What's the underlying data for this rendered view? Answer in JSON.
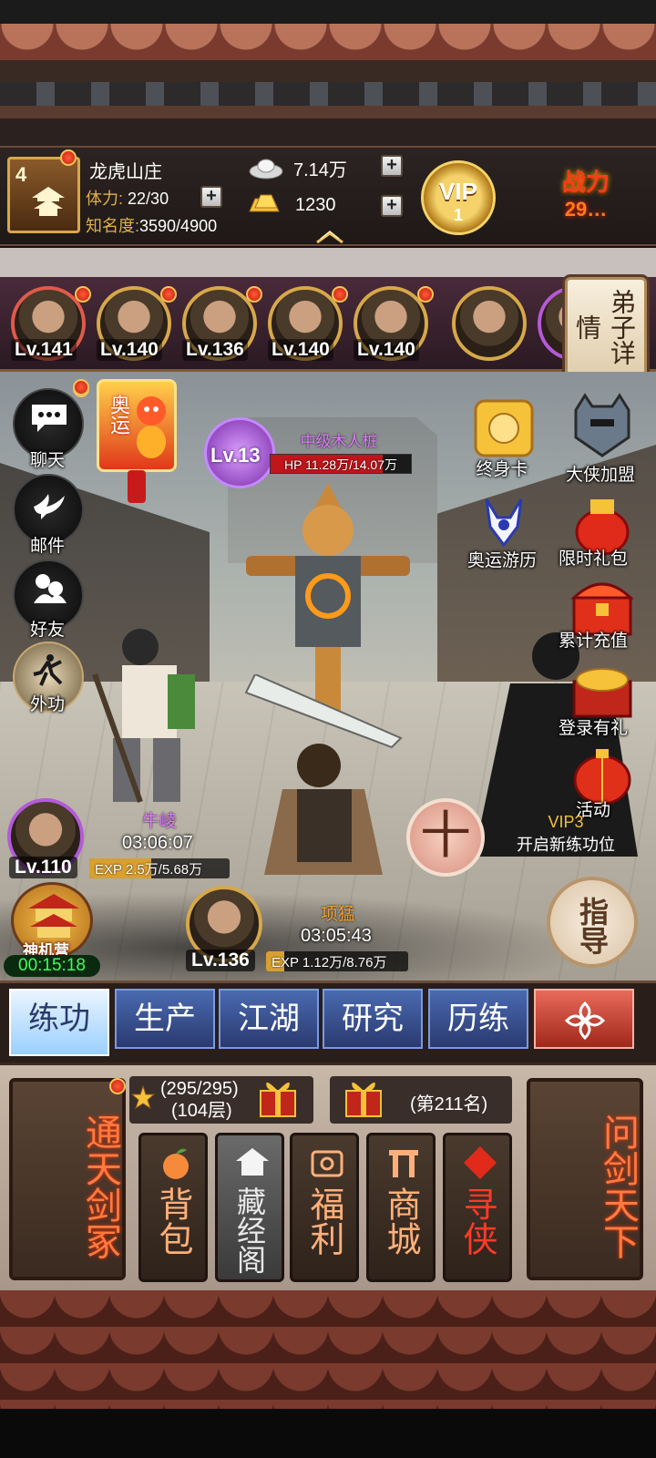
{
  "header": {
    "level": "4",
    "manor_name": "龙虎山庄",
    "stamina_label": "体力:",
    "stamina_value": "22/30",
    "fame_label": "知名度:",
    "fame_value": "3590/4900",
    "silver": "7.14万",
    "gold": "1230",
    "vip_label": "VIP",
    "vip_level": "1",
    "power_label": "战力",
    "power_value": "29…",
    "plus": "+"
  },
  "disciples": [
    {
      "level": "Lv.141"
    },
    {
      "level": "Lv.140"
    },
    {
      "level": "Lv.136"
    },
    {
      "level": "Lv.140"
    },
    {
      "level": "Lv.140"
    },
    {
      "level": ""
    }
  ],
  "disciple_detail_label": "弟子详情",
  "left_menu": {
    "chat": "聊天",
    "mail": "邮件",
    "friends": "好友",
    "external_skill": "外功"
  },
  "olympic_card": "奥运",
  "target": {
    "level": "Lv.13",
    "name": "中级木人桩",
    "hp_text": "HP 11.28万/14.07万",
    "hp_fraction": 0.8
  },
  "right_menu": {
    "lifetime_card": "终身卡",
    "hero_join": "大侠加盟",
    "olympic_tour": "奥运游历",
    "limited_pack": "限时礼包",
    "cumulative_recharge": "累计充值",
    "login_gift": "登录有礼",
    "events": "活动"
  },
  "training_slots": [
    {
      "name": "牛崚",
      "time": "03:06:07",
      "level": "Lv.110",
      "exp_text": "EXP 2.5万/5.68万",
      "exp_fraction": 0.44,
      "name_color": "#e07aff"
    },
    {
      "name": "项猛",
      "time": "03:05:43",
      "level": "Lv.136",
      "exp_text": "EXP 1.12万/8.76万",
      "exp_fraction": 0.13,
      "name_color": "#f0a030"
    }
  ],
  "add_slot_glyph": "十",
  "vip_slot": {
    "vip": "VIP3",
    "text": "开启新练功位"
  },
  "guide": "指导",
  "workshop": {
    "label": "神机营",
    "timer": "00:15:18"
  },
  "tabs": [
    "练功",
    "生产",
    "江湖",
    "研究",
    "历练"
  ],
  "bottom": {
    "tongtian": "通天剑冢",
    "wenjian": "问剑天下",
    "tower_progress": "(295/295)",
    "tower_floor": "(104层)",
    "rank": "(第211名)",
    "buttons": [
      "背包",
      "藏经阁",
      "福利",
      "商城",
      "寻侠"
    ]
  }
}
